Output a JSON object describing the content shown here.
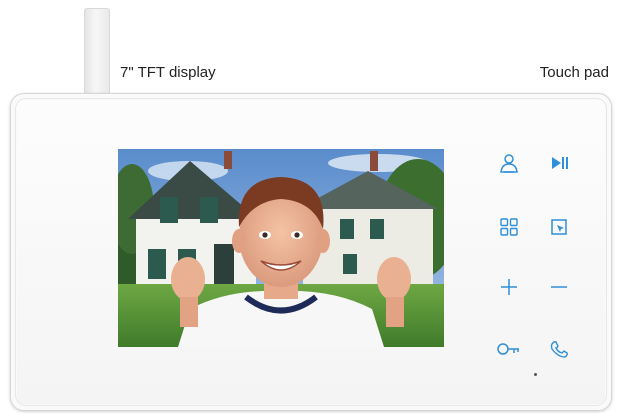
{
  "labels": {
    "display": "7\" TFT display",
    "touch_pad": "Touch pad"
  },
  "touch_pad": {
    "buttons": [
      {
        "name": "monitor-button",
        "icon": "person-icon"
      },
      {
        "name": "play-pause-button",
        "icon": "play-pause-icon"
      },
      {
        "name": "menu-button",
        "icon": "grid-menu-icon"
      },
      {
        "name": "snapshot-button",
        "icon": "snapshot-arrow-icon"
      },
      {
        "name": "volume-up-button",
        "icon": "plus-icon"
      },
      {
        "name": "volume-down-button",
        "icon": "minus-icon"
      },
      {
        "name": "unlock-button",
        "icon": "key-icon"
      },
      {
        "name": "talk-button",
        "icon": "phone-handset-icon"
      }
    ]
  },
  "colors": {
    "icon_blue": "#2f8fd8",
    "device_body": "#f7f7f7",
    "sky": "#6f9bd0",
    "grass": "#5f9a3a"
  }
}
